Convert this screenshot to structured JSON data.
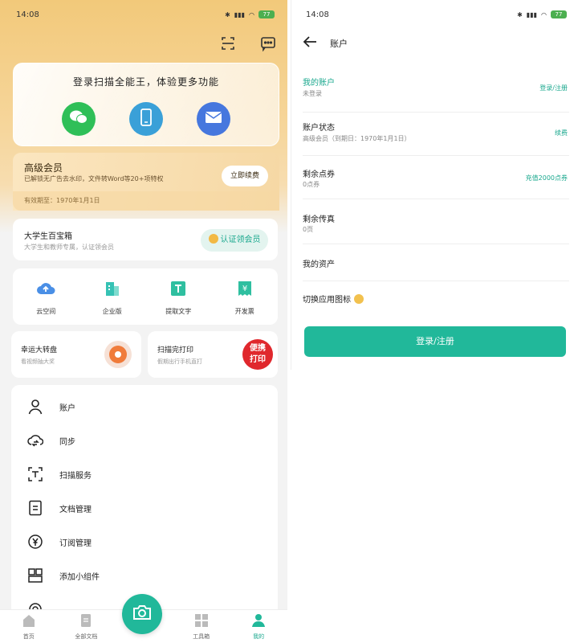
{
  "left": {
    "status": {
      "time": "14:08",
      "battery": "77"
    },
    "login_card": {
      "title": "登录扫描全能王，体验更多功能"
    },
    "vip": {
      "title": "高级会员",
      "desc": "已解锁无广告去水印，文件转Word等20+项特权",
      "button": "立即续费",
      "expiry": "有效期至：1970年1月1日"
    },
    "student": {
      "title": "大学生百宝箱",
      "desc": "大学生和教师专属，认证领会员",
      "button": "认证领会员"
    },
    "tools": [
      {
        "label": "云空间",
        "icon": "cloud-upload-icon"
      },
      {
        "label": "企业版",
        "icon": "building-icon"
      },
      {
        "label": "提取文字",
        "icon": "text-extract-icon"
      },
      {
        "label": "开发票",
        "icon": "invoice-icon"
      }
    ],
    "promos": [
      {
        "title": "幸运大转盘",
        "desc": "看视频抽大奖"
      },
      {
        "title": "扫描完打印",
        "desc": "假期出行手机直打",
        "badge_line1": "便携",
        "badge_line2": "打印"
      }
    ],
    "menu": [
      {
        "label": "账户",
        "icon": "user-icon"
      },
      {
        "label": "同步",
        "icon": "cloud-sync-icon"
      },
      {
        "label": "扫描服务",
        "icon": "scan-text-icon"
      },
      {
        "label": "文档管理",
        "icon": "document-icon"
      },
      {
        "label": "订阅管理",
        "icon": "yen-circle-icon"
      },
      {
        "label": "添加小组件",
        "icon": "widget-icon"
      }
    ],
    "nav": [
      {
        "label": "首页",
        "icon": "home-icon"
      },
      {
        "label": "全部文档",
        "icon": "docs-icon"
      },
      {
        "label": "工具箱",
        "icon": "toolbox-icon"
      },
      {
        "label": "我的",
        "icon": "profile-icon"
      }
    ]
  },
  "right": {
    "status": {
      "time": "14:08",
      "battery": "77"
    },
    "header_title": "账户",
    "rows": [
      {
        "title": "我的账户",
        "sub": "未登录",
        "right": "登录/注册"
      },
      {
        "title": "账户状态",
        "sub": "高级会员（到期日：1970年1月1日）",
        "right": "续费"
      },
      {
        "title": "剩余点券",
        "sub": "0点券",
        "right": "充值2000点券"
      },
      {
        "title": "剩余传真",
        "sub": "0页",
        "right": ""
      },
      {
        "title": "我的资产",
        "sub": "",
        "right": ""
      },
      {
        "title": "切换应用图标",
        "sub": "",
        "right": ""
      }
    ],
    "login_button": "登录/注册"
  },
  "colors": {
    "accent": "#21b89a",
    "vip_gold": "#f6d8a4",
    "wechat": "#2fbf58",
    "phone": "#3aa0d8",
    "mail": "#4677de",
    "print_red": "#e0282d"
  }
}
